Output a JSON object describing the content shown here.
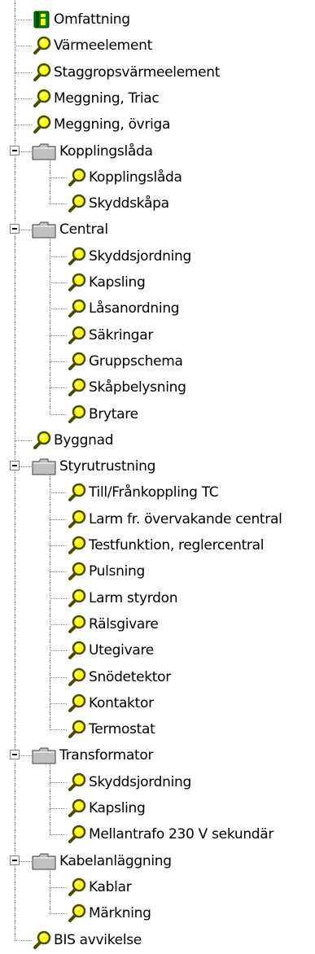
{
  "tree": {
    "nodes": [
      {
        "label": "Omfattning",
        "level": 1,
        "icon": "info-book-icon",
        "type": "leaf"
      },
      {
        "label": "Värmeelement",
        "level": 1,
        "icon": "magnifier-icon",
        "type": "leaf"
      },
      {
        "label": "Staggropsvärmeelement",
        "level": 1,
        "icon": "magnifier-icon",
        "type": "leaf"
      },
      {
        "label": "Meggning, Triac",
        "level": 1,
        "icon": "magnifier-icon",
        "type": "leaf"
      },
      {
        "label": "Meggning, övriga",
        "level": 1,
        "icon": "magnifier-icon",
        "type": "leaf"
      },
      {
        "label": "Kopplingslåda",
        "level": 1,
        "icon": "folder-icon",
        "type": "folder",
        "expanded": true
      },
      {
        "label": "Kopplingslåda",
        "level": 2,
        "icon": "magnifier-icon",
        "type": "leaf"
      },
      {
        "label": "Skyddskåpa",
        "level": 2,
        "icon": "magnifier-icon",
        "type": "leaf",
        "last": true
      },
      {
        "label": "Central",
        "level": 1,
        "icon": "folder-icon",
        "type": "folder",
        "expanded": true
      },
      {
        "label": "Skyddsjordning",
        "level": 2,
        "icon": "magnifier-icon",
        "type": "leaf"
      },
      {
        "label": "Kapsling",
        "level": 2,
        "icon": "magnifier-icon",
        "type": "leaf"
      },
      {
        "label": "Låsanordning",
        "level": 2,
        "icon": "magnifier-icon",
        "type": "leaf"
      },
      {
        "label": "Säkringar",
        "level": 2,
        "icon": "magnifier-icon",
        "type": "leaf"
      },
      {
        "label": "Gruppschema",
        "level": 2,
        "icon": "magnifier-icon",
        "type": "leaf"
      },
      {
        "label": "Skåpbelysning",
        "level": 2,
        "icon": "magnifier-icon",
        "type": "leaf"
      },
      {
        "label": "Brytare",
        "level": 2,
        "icon": "magnifier-icon",
        "type": "leaf",
        "last": true
      },
      {
        "label": "Byggnad",
        "level": 1,
        "icon": "magnifier-icon",
        "type": "leaf"
      },
      {
        "label": "Styrutrustning",
        "level": 1,
        "icon": "folder-icon",
        "type": "folder",
        "expanded": true
      },
      {
        "label": "Till/Frånkoppling TC",
        "level": 2,
        "icon": "magnifier-icon",
        "type": "leaf"
      },
      {
        "label": "Larm fr. övervakande central",
        "level": 2,
        "icon": "magnifier-icon",
        "type": "leaf"
      },
      {
        "label": "Testfunktion, reglercentral",
        "level": 2,
        "icon": "magnifier-icon",
        "type": "leaf"
      },
      {
        "label": "Pulsning",
        "level": 2,
        "icon": "magnifier-icon",
        "type": "leaf"
      },
      {
        "label": "Larm styrdon",
        "level": 2,
        "icon": "magnifier-icon",
        "type": "leaf"
      },
      {
        "label": "Rälsgivare",
        "level": 2,
        "icon": "magnifier-icon",
        "type": "leaf"
      },
      {
        "label": "Utegivare",
        "level": 2,
        "icon": "magnifier-icon",
        "type": "leaf"
      },
      {
        "label": "Snödetektor",
        "level": 2,
        "icon": "magnifier-icon",
        "type": "leaf"
      },
      {
        "label": "Kontaktor",
        "level": 2,
        "icon": "magnifier-icon",
        "type": "leaf"
      },
      {
        "label": "Termostat",
        "level": 2,
        "icon": "magnifier-icon",
        "type": "leaf",
        "last": true
      },
      {
        "label": "Transformator",
        "level": 1,
        "icon": "folder-icon",
        "type": "folder",
        "expanded": true
      },
      {
        "label": "Skyddsjordning",
        "level": 2,
        "icon": "magnifier-icon",
        "type": "leaf"
      },
      {
        "label": "Kapsling",
        "level": 2,
        "icon": "magnifier-icon",
        "type": "leaf"
      },
      {
        "label": "Mellantrafo 230 V sekundär",
        "level": 2,
        "icon": "magnifier-icon",
        "type": "leaf",
        "last": true
      },
      {
        "label": "Kabelanläggning",
        "level": 1,
        "icon": "folder-icon",
        "type": "folder",
        "expanded": true
      },
      {
        "label": "Kablar",
        "level": 2,
        "icon": "magnifier-icon",
        "type": "leaf"
      },
      {
        "label": "Märkning",
        "level": 2,
        "icon": "magnifier-icon",
        "type": "leaf",
        "last": true
      },
      {
        "label": "BIS avvikelse",
        "level": 1,
        "icon": "magnifier-icon",
        "type": "leaf"
      }
    ]
  },
  "colors": {
    "background": "#ffffff",
    "text": "#000000",
    "connector": "#808080",
    "folder_fill": "#c0c0c0",
    "magnifier_rim": "#4a4a00",
    "magnifier_lens": "#ffff00",
    "book_green": "#008000",
    "book_yellow": "#ffff00"
  }
}
